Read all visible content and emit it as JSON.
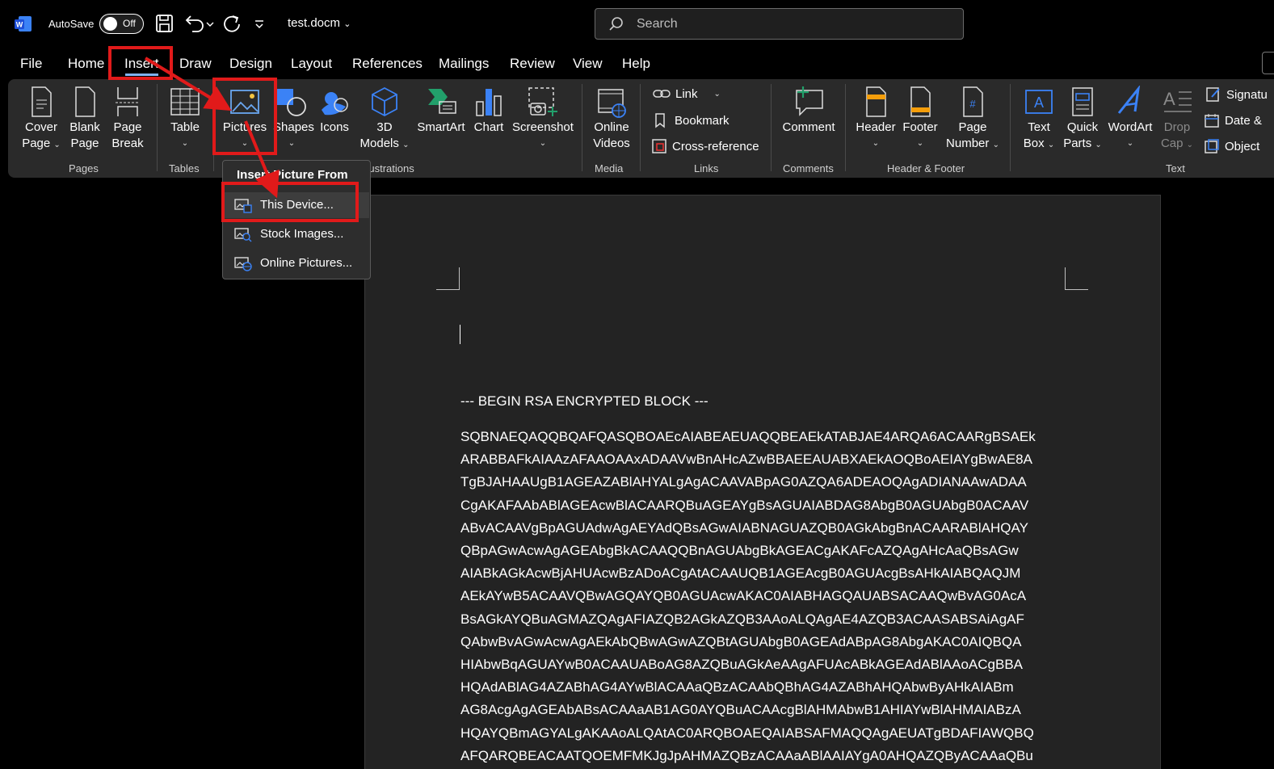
{
  "titlebar": {
    "autosave_label": "AutoSave",
    "autosave_state": "Off",
    "filename": "test.docm",
    "search_placeholder": "Search"
  },
  "tabs": [
    "File",
    "Home",
    "Insert",
    "Draw",
    "Design",
    "Layout",
    "References",
    "Mailings",
    "Review",
    "View",
    "Help"
  ],
  "ribbon": {
    "pages": {
      "cover_page": [
        "Cover",
        "Page"
      ],
      "blank_page": [
        "Blank",
        "Page"
      ],
      "page_break": [
        "Page",
        "Break"
      ],
      "label": "Pages"
    },
    "tables": {
      "table": "Table",
      "label": "Tables"
    },
    "illustrations": {
      "pictures": "Pictures",
      "shapes": "Shapes",
      "icons": "Icons",
      "models": [
        "3D",
        "Models"
      ],
      "smartart": "SmartArt",
      "chart": "Chart",
      "screenshot": "Screenshot",
      "label": "Illustrations"
    },
    "media": {
      "online_videos": [
        "Online",
        "Videos"
      ],
      "label": "Media"
    },
    "links": {
      "link": "Link",
      "bookmark": "Bookmark",
      "cross_reference": "Cross-reference",
      "label": "Links"
    },
    "comments": {
      "comment": "Comment",
      "label": "Comments"
    },
    "header_footer": {
      "header": "Header",
      "footer": "Footer",
      "page_number": [
        "Page",
        "Number"
      ],
      "label": "Header & Footer"
    },
    "text": {
      "text_box": [
        "Text",
        "Box"
      ],
      "quick_parts": [
        "Quick",
        "Parts"
      ],
      "wordart": "WordArt",
      "drop_cap": [
        "Drop",
        "Cap"
      ],
      "signature": "Signatu",
      "date_time": "Date &",
      "object": "Object",
      "label": "Text"
    }
  },
  "dropdown": {
    "header": "Insert Picture From",
    "items": [
      "This Device...",
      "Stock Images...",
      "Online Pictures..."
    ]
  },
  "document": {
    "begin_marker": "--- BEGIN RSA ENCRYPTED BLOCK ---",
    "lines": [
      "SQBNAEQAQQBQAFQASQBOAEcAIABEAEUAQQBEAEkATABJAE4ARQA6ACAARgBSAEk",
      "ARABBAFkAIAAzAFAAOAAxADAAVwBnAHcAZwBBAEEAUABXAEkAOQBoAEIAYgBwAE8A",
      "TgBJAHAAUgB1AGEAZABlAHYALgAgACAAVABpAG0AZQA6ADEAOQAgADIANAAwADAA",
      "CgAKAFAAbABlAGEAcwBlACAARQBuAGEAYgBsAGUAIABDAG8AbgB0AGUAbgB0ACAAV",
      "ABvACAAVgBpAGUAdwAgAEYAdQBsAGwAIABNAGUAZQB0AGkAbgBnACAARABlAHQAY",
      "QBpAGwAcwAgAGEAbgBkACAAQQBnAGUAbgBkAGEACgAKAFcAZQAgAHcAaQBsAGw",
      "AIABkAGkAcwBjAHUAcwBzADoACgAtACAAUQB1AGEAcgB0AGUAcgBsAHkAIABQAQJM",
      "AEkAYwB5ACAAVQBwAGQAYQB0AGUAcwAKAC0AIABHAGQAUABSACAAQwBvAG0AcA",
      "BsAGkAYQBuAGMAZQAgAFIAZQB2AGkAZQB3AAoALQAgAE4AZQB3ACAASABSAiAgAF",
      "QAbwBvAGwAcwAgAEkAbQBwAGwAZQBtAGUAbgB0AGEAdABpAG8AbgAKAC0AIQBQA",
      "HIAbwBqAGUAYwB0ACAAUABoAG8AZQBuAGkAeAAgAFUAcABkAGEAdABlAAoACgBBA",
      "HQAdABlAG4AZABhAG4AYwBlACAAaQBzACAAbQBhAG4AZABhAHQAbwByAHkAIABm",
      "AG8AcgAgAGEAbABsACAAaAB1AG0AYQBuACAAcgBlAHMAbwB1AHIAYwBlAHMAIABzA",
      "HQAYQBmAGYALgAKAAoALQAtAC0ARQBOAEQAIABSAFMAQQAgAEUATgBDAFIAWQBQ",
      "AFQARQBEACAATQOEMFMKJgJpAHMAZQBzACAAaABlAAIAYgA0AHQAZQByACAAaQBu"
    ]
  },
  "colors": {
    "annotation": "#e11a1a",
    "accent": "#7fb2f0",
    "ribbon_bg": "#2a2a2a",
    "doc_bg": "#232323"
  }
}
